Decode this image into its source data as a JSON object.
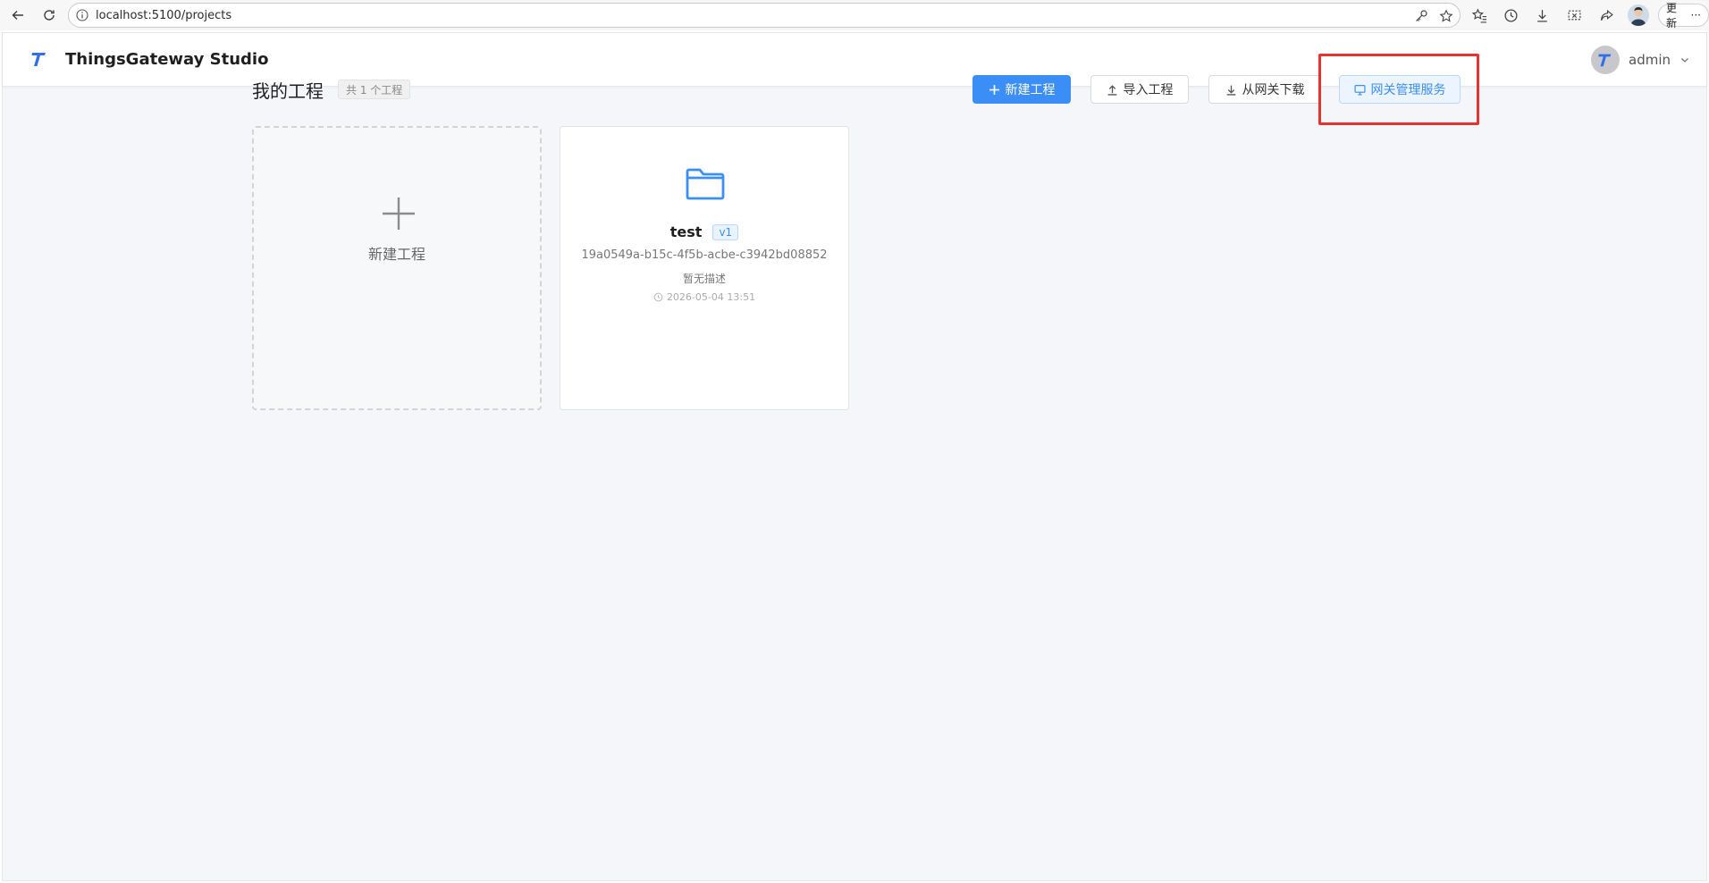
{
  "browser": {
    "url": "localhost:5100/projects",
    "update_label": "更新",
    "more_label": "···"
  },
  "app": {
    "title": "ThingsGateway Studio",
    "user": "admin",
    "logo_letter": "T"
  },
  "page": {
    "title": "我的工程",
    "count_badge": "共 1 个工程"
  },
  "toolbar": {
    "new_project": "新建工程",
    "import_project": "导入工程",
    "download_from_gateway": "从网关下载",
    "gateway_service": "网关管理服务"
  },
  "cards": {
    "new_card_label": "新建工程",
    "project": {
      "name": "test",
      "version": "v1",
      "id": "19a0549a-b15c-4f5b-acbe-c3942bd08852",
      "description": "暂无描述",
      "time": "2026-05-04 13:51"
    }
  },
  "colors": {
    "primary": "#3b8ef6",
    "highlight": "#e8322d",
    "page_bg": "#f4f6f9"
  }
}
